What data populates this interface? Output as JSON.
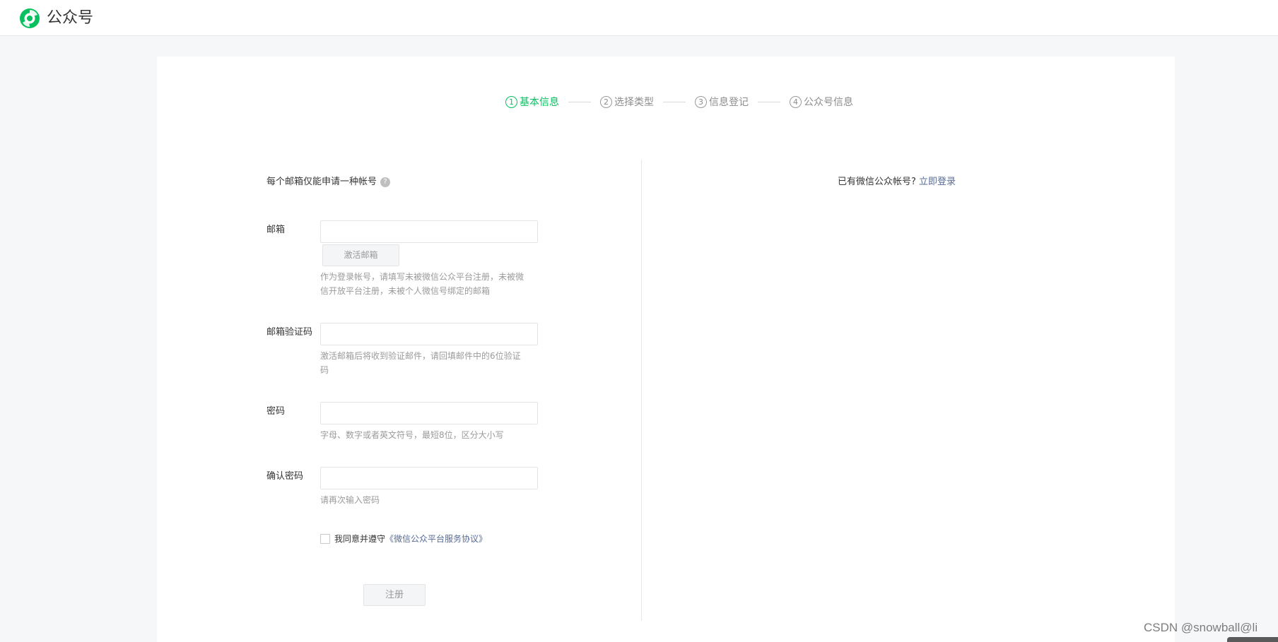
{
  "header": {
    "logo_icon": "wechat-official-account-logo-icon",
    "brand": "公众号",
    "accent_color": "#07c160"
  },
  "steps": [
    {
      "number": "1",
      "label": "基本信息",
      "active": true
    },
    {
      "number": "2",
      "label": "选择类型",
      "active": false
    },
    {
      "number": "3",
      "label": "信息登记",
      "active": false
    },
    {
      "number": "4",
      "label": "公众号信息",
      "active": false
    }
  ],
  "form": {
    "tip": "每个邮箱仅能申请一种帐号",
    "help_icon": "?",
    "email": {
      "label": "邮箱",
      "value": "",
      "placeholder": "",
      "activate_button": "激活邮箱",
      "hint": "作为登录帐号，请填写未被微信公众平台注册，未被微信开放平台注册，未被个人微信号绑定的邮箱"
    },
    "code": {
      "label": "邮箱验证码",
      "value": "",
      "placeholder": "",
      "hint": "激活邮箱后将收到验证邮件，请回填邮件中的6位验证码"
    },
    "password": {
      "label": "密码",
      "value": "",
      "placeholder": "",
      "hint": "字母、数字或者英文符号，最短8位，区分大小写"
    },
    "confirm": {
      "label": "确认密码",
      "value": "",
      "placeholder": "",
      "hint": "请再次输入密码"
    },
    "agree": {
      "checked": false,
      "text": "我同意并遵守",
      "link": "《微信公众平台服务协议》"
    },
    "register_button": "注册"
  },
  "login": {
    "text": "已有微信公众帐号?",
    "link": "立即登录"
  },
  "watermark": "CSDN @snowball@li"
}
